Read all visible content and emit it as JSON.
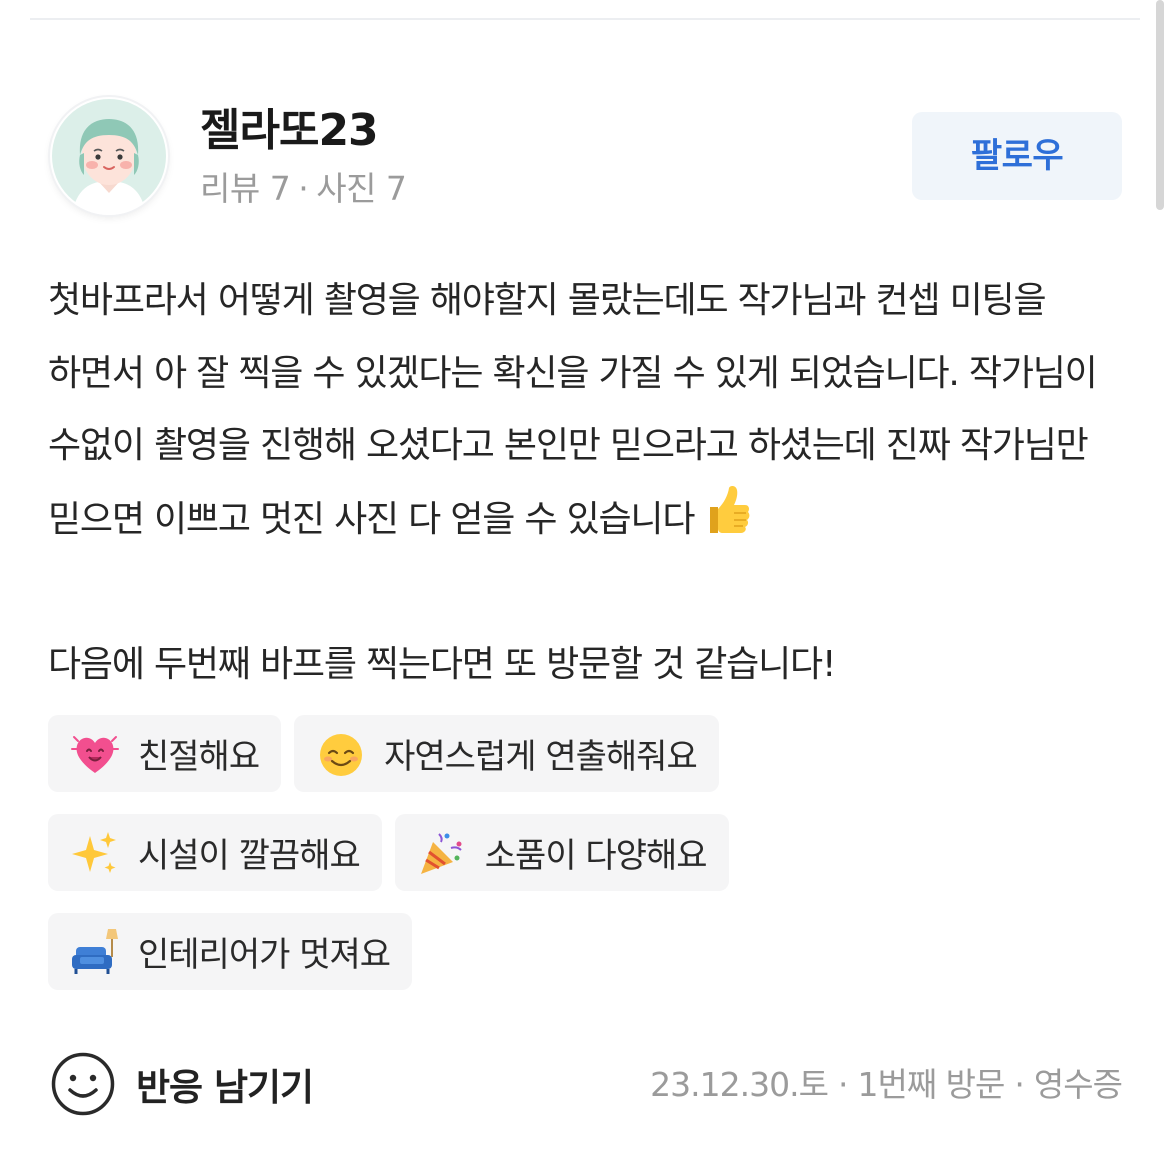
{
  "user": {
    "name": "젤라또23",
    "review_count": "리뷰 7",
    "separator": "·",
    "photo_count": "사진 7"
  },
  "follow_button": {
    "label": "팔로우"
  },
  "review": {
    "text": "첫바프라서 어떻게 촬영을 해야할지 몰랐는데도 작가님과 컨셉 미팅을 하면서 아 잘 찍을 수 있겠다는 확신을 가질 수 있게 되었습니다. 작가님이 수없이 촬영을 진행해 오셨다고 본인만 믿으라고 하셨는데 진짜 작가님만 믿으면 이쁘고 멋진 사진 다 얻을 수 있습니다",
    "emoji": "thumbs-up-icon",
    "text_2": "다음에 두번째 바프를 찍는다면 또 방문할 것 같습니다!"
  },
  "tags": [
    {
      "icon": "sparkling-heart-icon",
      "label": "친절해요"
    },
    {
      "icon": "relieved-face-icon",
      "label": "자연스럽게 연출해줘요"
    },
    {
      "icon": "sparkles-icon",
      "label": "시설이 깔끔해요"
    },
    {
      "icon": "party-popper-icon",
      "label": "소품이 다양해요"
    },
    {
      "icon": "couch-lamp-icon",
      "label": "인테리어가 멋져요"
    }
  ],
  "reaction": {
    "icon": "smile-icon",
    "label": "반응 남기기"
  },
  "meta": {
    "date": "23.12.30.토",
    "separator": "·",
    "visit": "1번째 방문",
    "receipt": "영수증"
  },
  "colors": {
    "follow_bg": "#f0f5fa",
    "follow_text": "#2e6fd8",
    "tag_bg": "#f5f5f6",
    "muted_text": "#9b9b9b"
  }
}
